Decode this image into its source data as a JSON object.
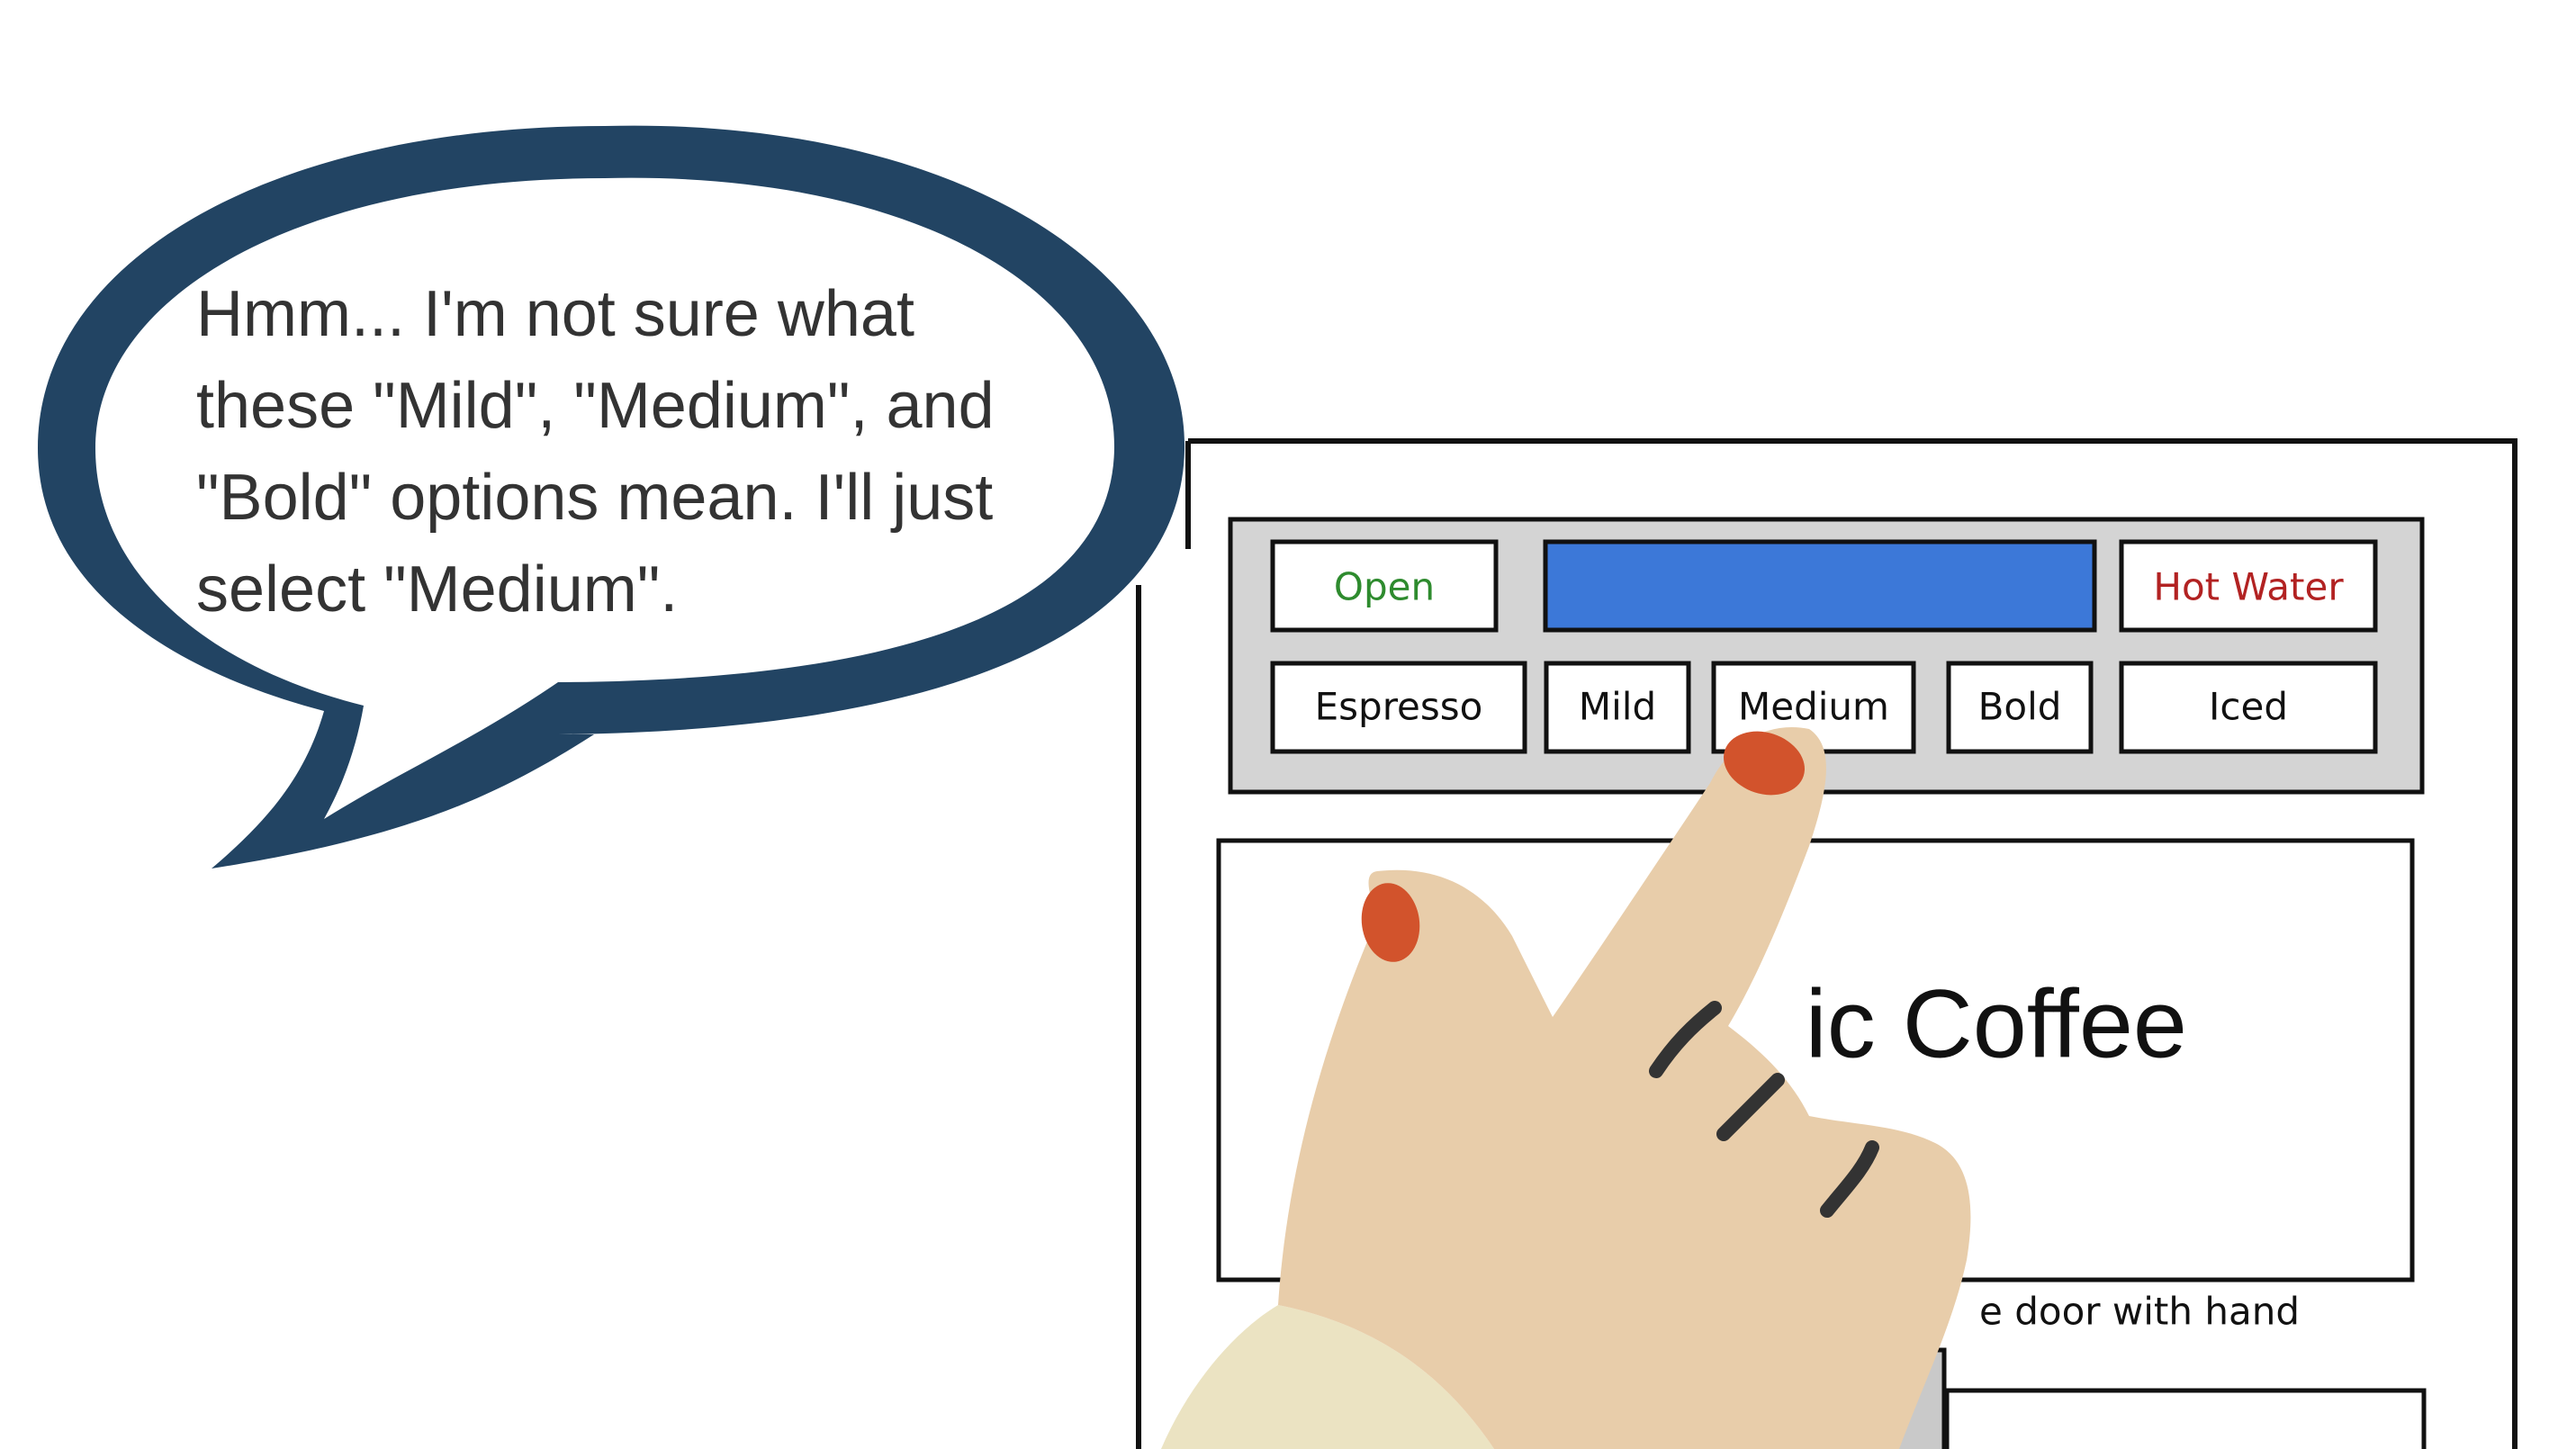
{
  "speech_bubble": {
    "lines": [
      "Hmm... I'm not sure what",
      "these \"Mild\", \"Medium\", and",
      "\"Bold\" options mean. I'll just",
      "select \"Medium\"."
    ],
    "outline_color": "#224463"
  },
  "machine": {
    "top_row": {
      "open_label": "Open",
      "hot_water_label": "Hot Water"
    },
    "bottom_row": {
      "espresso_label": "Espresso",
      "mild_label": "Mild",
      "medium_label": "Medium",
      "bold_label": "Bold",
      "iced_label": "Iced"
    },
    "display_color": "#3c78d8",
    "brand_visible_text": "ic Coffee",
    "instruction_visible_text": "e door with hand"
  },
  "colors": {
    "open_text": "#2e8b2e",
    "hot_water_text": "#b22222",
    "skin": "#e8cdaa",
    "nail": "#d2532c",
    "sleeve": "#ebe3c2"
  }
}
